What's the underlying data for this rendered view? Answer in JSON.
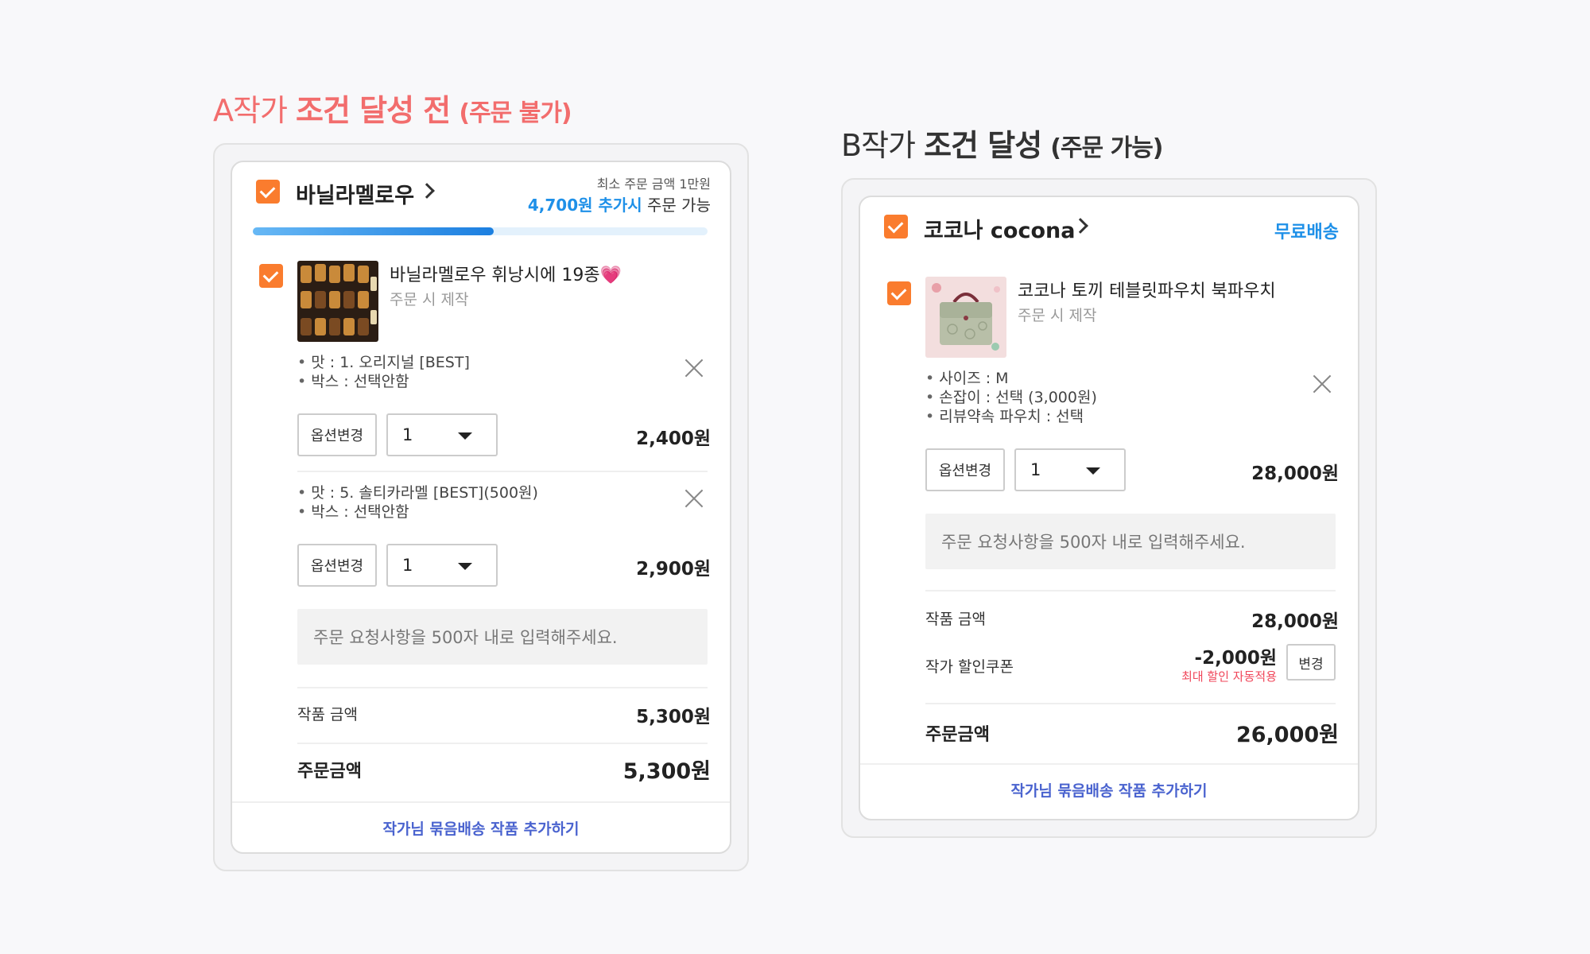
{
  "heading_a": {
    "prefix": "A작가 ",
    "emph": "조건 달성 전",
    "paren": "(주문 불가)"
  },
  "heading_b": {
    "prefix": "B작가 ",
    "emph": "조건 달성",
    "paren": "(주문 가능)"
  },
  "card_a": {
    "shop_name": "바닐라멜로우",
    "min_order": "최소 주문 금액 1만원",
    "need_more_amount": "4,700원 추가시",
    "need_more_suffix": " 주문 가능",
    "progress": 0.53,
    "item_title": "바닐라멜로우 휘낭시에 19종💗",
    "item_sub": "주문 시 제작",
    "options": [
      {
        "lines": [
          "맛 : 1. 오리지널 [BEST]",
          "박스 : 선택안함"
        ],
        "change_label": "옵션변경",
        "qty": "1",
        "price": "2,400원"
      },
      {
        "lines": [
          "맛 : 5. 솔티카라멜 [BEST](500원)",
          "박스 : 선택안함"
        ],
        "change_label": "옵션변경",
        "qty": "1",
        "price": "2,900원"
      }
    ],
    "memo_placeholder": "주문 요청사항을 500자 내로 입력해주세요.",
    "subtotal_label": "작품 금액",
    "subtotal_value": "5,300원",
    "total_label": "주문금액",
    "total_value": "5,300원",
    "footer_link": "작가님 묶음배송 작품 추가하기"
  },
  "card_b": {
    "shop_name": "코코나 cocona",
    "free_shipping": "무료배송",
    "item_title": "코코나 토끼 테블릿파우치 북파우치",
    "item_sub": "주문 시 제작",
    "options": {
      "lines": [
        "사이즈 : M",
        "손잡이 : 선택 (3,000원)",
        "리뷰약속 파우치 : 선택"
      ],
      "change_label": "옵션변경",
      "qty": "1",
      "price": "28,000원"
    },
    "memo_placeholder": "주문 요청사항을 500자 내로 입력해주세요.",
    "subtotal_label": "작품 금액",
    "subtotal_value": "28,000원",
    "coupon_label": "작가 할인쿠폰",
    "coupon_value": "-2,000원",
    "coupon_note": "최대 할인 자동적용",
    "coupon_change": "변경",
    "total_label": "주문금액",
    "total_value": "26,000원",
    "footer_link": "작가님 묶음배송 작품 추가하기"
  },
  "colors": {
    "accent_orange": "#fa7c2e",
    "blue": "#1e90e8",
    "coral": "#f26d6d",
    "link": "#4a63cf",
    "red_note": "#f0465a"
  }
}
